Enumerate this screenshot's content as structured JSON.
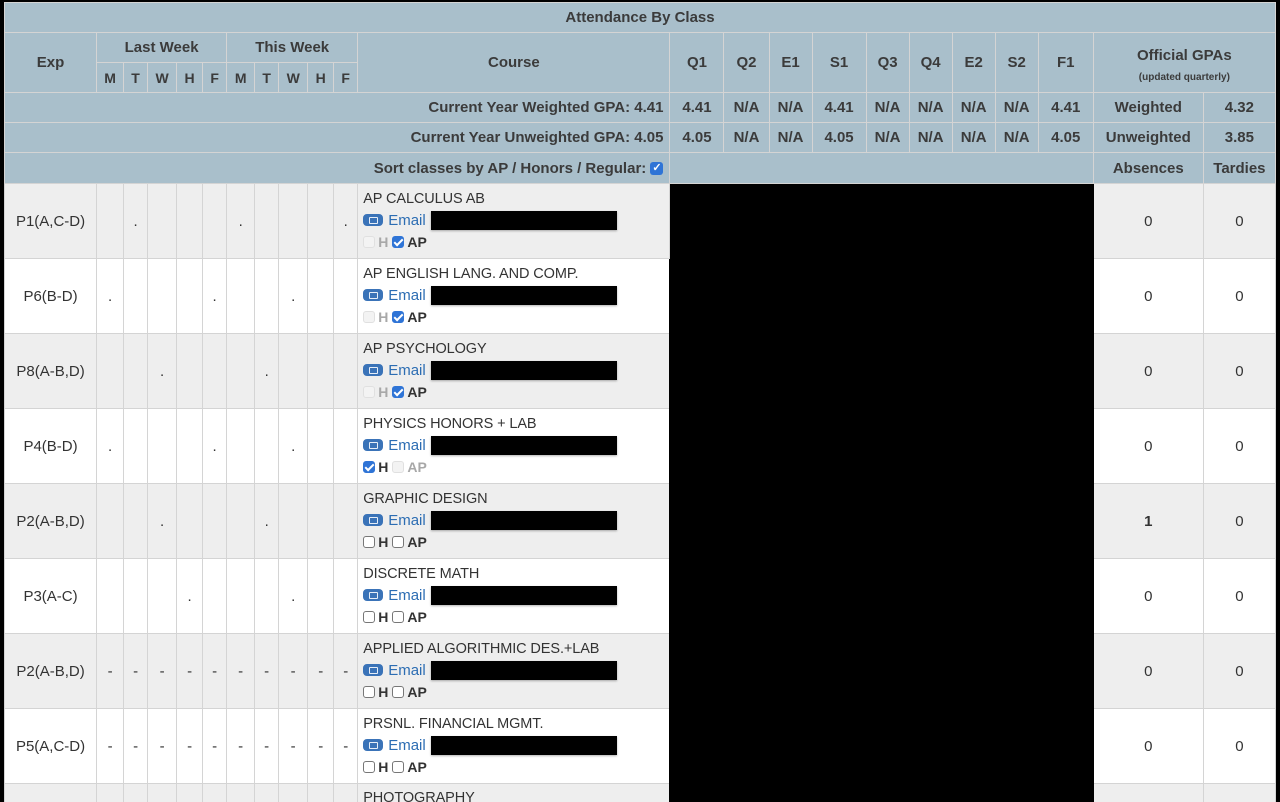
{
  "title": "Attendance By Class",
  "headers": {
    "exp": "Exp",
    "last_week": "Last Week",
    "this_week": "This Week",
    "days": [
      "M",
      "T",
      "W",
      "H",
      "F",
      "M",
      "T",
      "W",
      "H",
      "F"
    ],
    "course": "Course",
    "terms": [
      "Q1",
      "Q2",
      "E1",
      "S1",
      "Q3",
      "Q4",
      "E2",
      "S2",
      "F1"
    ],
    "official_gpas": "Official GPAs",
    "official_gpas_note": "(updated quarterly)",
    "absences": "Absences",
    "tardies": "Tardies"
  },
  "gpa_rows": [
    {
      "label": "Current Year Weighted GPA: 4.41",
      "terms": [
        "4.41",
        "N/A",
        "N/A",
        "4.41",
        "N/A",
        "N/A",
        "N/A",
        "N/A",
        "4.41"
      ],
      "official_label": "Weighted",
      "official_value": "4.32"
    },
    {
      "label": "Current Year Unweighted GPA: 4.05",
      "terms": [
        "4.05",
        "N/A",
        "N/A",
        "4.05",
        "N/A",
        "N/A",
        "N/A",
        "N/A",
        "4.05"
      ],
      "official_label": "Unweighted",
      "official_value": "3.85"
    }
  ],
  "sort": {
    "label": "Sort classes by AP / Honors / Regular:",
    "checked": true
  },
  "email_label": "Email",
  "honors_label": "H",
  "ap_label": "AP",
  "classes": [
    {
      "exp": "P1(A,C-D)",
      "days": [
        "",
        ".",
        "",
        "",
        "",
        ".",
        "",
        "",
        "",
        "."
      ],
      "course": "AP CALCULUS AB",
      "h": {
        "checked": false,
        "disabled": true
      },
      "ap": {
        "checked": true,
        "disabled": false
      },
      "absences": "0",
      "tardies": "0"
    },
    {
      "exp": "P6(B-D)",
      "days": [
        ".",
        "",
        "",
        "",
        ".",
        "",
        "",
        ".",
        "",
        ""
      ],
      "course": "AP ENGLISH LANG. AND COMP.",
      "h": {
        "checked": false,
        "disabled": true
      },
      "ap": {
        "checked": true,
        "disabled": false
      },
      "absences": "0",
      "tardies": "0"
    },
    {
      "exp": "P8(A-B,D)",
      "days": [
        "",
        "",
        ".",
        "",
        "",
        "",
        ".",
        "",
        "",
        ""
      ],
      "course": "AP PSYCHOLOGY",
      "h": {
        "checked": false,
        "disabled": true
      },
      "ap": {
        "checked": true,
        "disabled": false
      },
      "absences": "0",
      "tardies": "0"
    },
    {
      "exp": "P4(B-D)",
      "days": [
        ".",
        "",
        "",
        "",
        ".",
        "",
        "",
        ".",
        "",
        ""
      ],
      "course": "PHYSICS HONORS + LAB",
      "h": {
        "checked": true,
        "disabled": false
      },
      "ap": {
        "checked": false,
        "disabled": true
      },
      "absences": "0",
      "tardies": "0"
    },
    {
      "exp": "P2(A-B,D)",
      "days": [
        "",
        "",
        ".",
        "",
        "",
        "",
        ".",
        "",
        "",
        ""
      ],
      "course": "GRAPHIC DESIGN",
      "h": {
        "checked": false,
        "disabled": false
      },
      "ap": {
        "checked": false,
        "disabled": false
      },
      "absences": "1",
      "tardies": "0"
    },
    {
      "exp": "P3(A-C)",
      "days": [
        "",
        "",
        "",
        ".",
        "",
        "",
        "",
        ".",
        "",
        ""
      ],
      "course": "DISCRETE MATH",
      "h": {
        "checked": false,
        "disabled": false
      },
      "ap": {
        "checked": false,
        "disabled": false
      },
      "absences": "0",
      "tardies": "0"
    },
    {
      "exp": "P2(A-B,D)",
      "days": [
        "-",
        "-",
        "-",
        "-",
        "-",
        "-",
        "-",
        "-",
        "-",
        "-"
      ],
      "course": "APPLIED ALGORITHMIC DES.+LAB",
      "h": {
        "checked": false,
        "disabled": false
      },
      "ap": {
        "checked": false,
        "disabled": false
      },
      "absences": "0",
      "tardies": "0"
    },
    {
      "exp": "P5(A,C-D)",
      "days": [
        "-",
        "-",
        "-",
        "-",
        "-",
        "-",
        "-",
        "-",
        "-",
        "-"
      ],
      "course": "PRSNL. FINANCIAL MGMT.",
      "h": {
        "checked": false,
        "disabled": false
      },
      "ap": {
        "checked": false,
        "disabled": false
      },
      "absences": "0",
      "tardies": "0"
    }
  ],
  "partial_row": {
    "course": "PHOTOGRAPHY"
  },
  "colors": {
    "header_bg": "#a9bfcb",
    "link": "#2c6db3",
    "checkbox": "#2f74d6",
    "row_alt": "#eeeeee"
  }
}
